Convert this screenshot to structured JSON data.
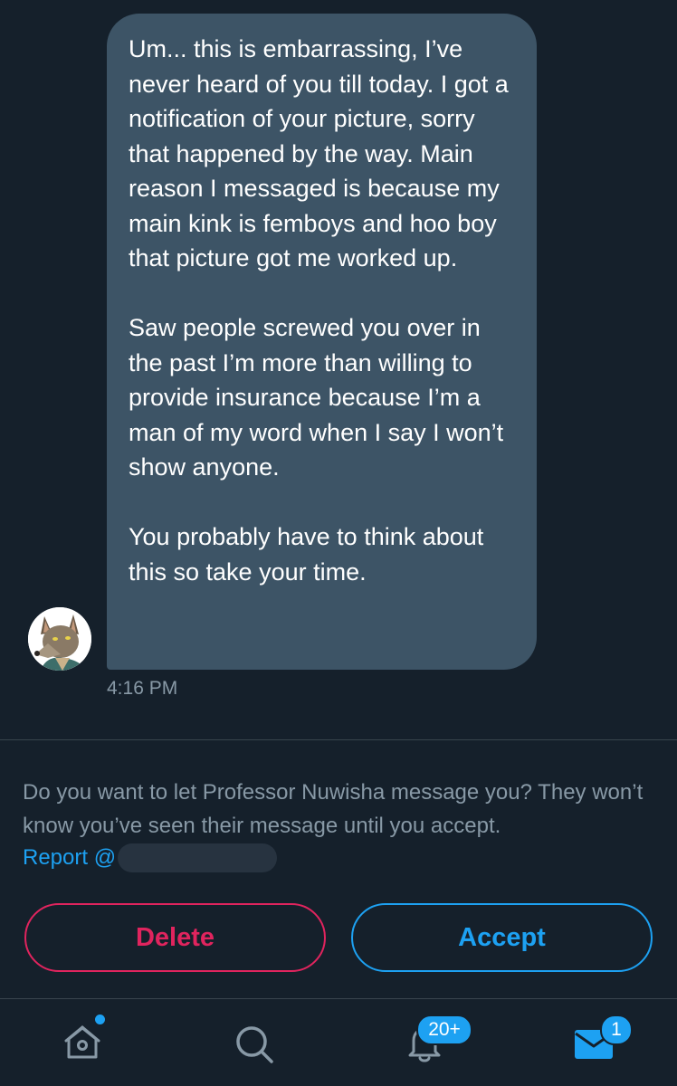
{
  "conversation": {
    "message": {
      "paragraphs": [
        "Um... this is embarrassing, I’ve never heard of you till today. I got a notification of your picture, sorry that happened by the way. Main reason I messaged is because my main kink is femboys and hoo boy that picture got me worked up.",
        "Saw people screwed you over in the past I’m more than willing to provide insurance because I’m a man of my word when I say I won’t show anyone.",
        "You probably have to think about this so take your time."
      ],
      "timestamp": "4:16 PM"
    },
    "avatar_icon": "wolf-avatar"
  },
  "request": {
    "prompt": "Do you want to let Professor Nuwisha message you? They won’t know you’ve seen their message until you accept.",
    "report_label": "Report @",
    "delete_label": "Delete",
    "accept_label": "Accept"
  },
  "tab_bar": {
    "items": [
      {
        "name": "home",
        "icon": "home-icon",
        "has_dot": true
      },
      {
        "name": "search",
        "icon": "search-icon"
      },
      {
        "name": "notifications",
        "icon": "bell-icon",
        "badge": "20+"
      },
      {
        "name": "messages",
        "icon": "envelope-icon",
        "badge": "1",
        "active": true
      }
    ]
  },
  "colors": {
    "background": "#15202b",
    "bubble": "#3d5466",
    "accent": "#1da1f2",
    "danger": "#e0245e",
    "muted_text": "#8899a6"
  }
}
